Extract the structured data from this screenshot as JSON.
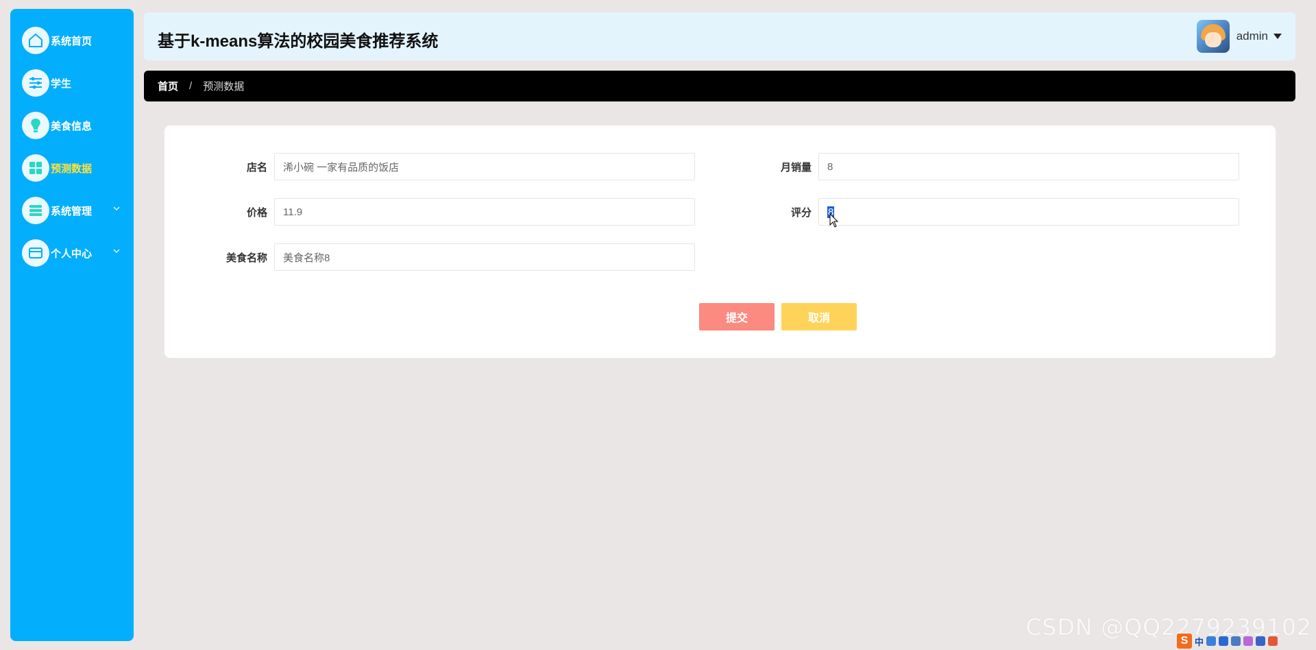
{
  "header": {
    "title": "基于k-means算法的校园美食推荐系统",
    "username": "admin"
  },
  "sidebar": {
    "items": [
      {
        "label": "系统首页",
        "icon": "home-icon"
      },
      {
        "label": "学生",
        "icon": "sliders-icon"
      },
      {
        "label": "美食信息",
        "icon": "bulb-icon"
      },
      {
        "label": "预测数据",
        "icon": "grid-icon",
        "active": true
      },
      {
        "label": "系统管理",
        "icon": "list-icon",
        "expandable": true
      },
      {
        "label": "个人中心",
        "icon": "card-icon",
        "expandable": true
      }
    ]
  },
  "breadcrumb": {
    "home": "首页",
    "separator": "/",
    "current": "预测数据"
  },
  "form": {
    "store_name": {
      "label": "店名",
      "value": "浠小碗 一家有品质的饭店"
    },
    "monthly_sales": {
      "label": "月销量",
      "value": "8"
    },
    "price": {
      "label": "价格",
      "value": "11.9"
    },
    "rating": {
      "label": "评分",
      "value": "8"
    },
    "food_name": {
      "label": "美食名称",
      "value": "美食名称8"
    },
    "submit_label": "提交",
    "cancel_label": "取消"
  },
  "watermark": "CSDN @QQ2279239102",
  "ime": {
    "mode": "中"
  },
  "colors": {
    "sidebar": "#03aefc",
    "active_text": "#ffe23b",
    "header_bg": "#e4f4fd",
    "submit": "#fb8a80",
    "cancel": "#ffd35a"
  }
}
